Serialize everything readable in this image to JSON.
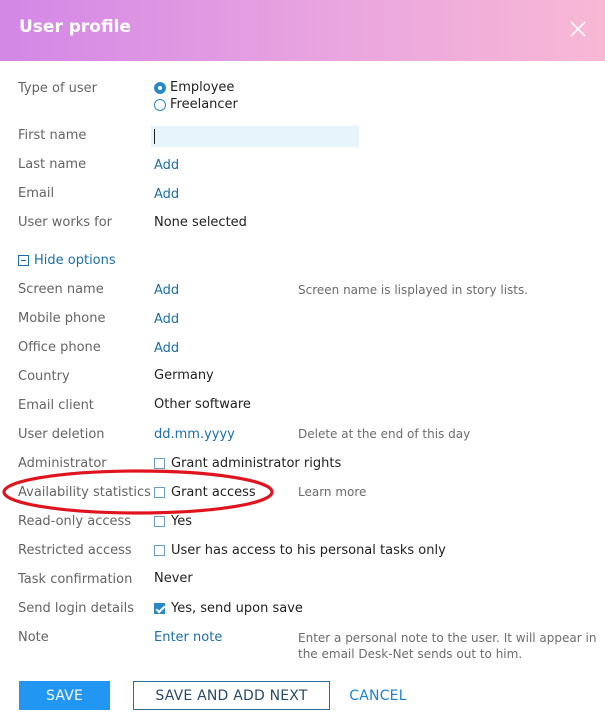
{
  "dialog": {
    "title": "User profile"
  },
  "rows": {
    "type_of_user": {
      "label": "Type of user",
      "options": [
        "Employee",
        "Freelancer"
      ],
      "selected": "Employee"
    },
    "first_name": {
      "label": "First name",
      "value": ""
    },
    "last_name": {
      "label": "Last name",
      "link": "Add"
    },
    "email": {
      "label": "Email",
      "link": "Add"
    },
    "works_for": {
      "label": "User works for",
      "value": "None selected"
    },
    "hide_options": {
      "label": "Hide options"
    },
    "screen_name": {
      "label": "Screen name",
      "link": "Add",
      "hint": "Screen name is  lisplayed in story lists."
    },
    "mobile_phone": {
      "label": "Mobile phone",
      "link": "Add"
    },
    "office_phone": {
      "label": "Office phone",
      "link": "Add"
    },
    "country": {
      "label": "Country",
      "value": "Germany"
    },
    "email_client": {
      "label": "Email client",
      "value": "Other software"
    },
    "user_deletion": {
      "label": "User deletion",
      "link": "dd.mm.yyyy",
      "hint": "Delete at the end of this day"
    },
    "administrator": {
      "label": "Administrator",
      "check_label": "Grant administrator rights",
      "checked": false
    },
    "availability": {
      "label": "Availability statistics",
      "check_label": "Grant access",
      "checked": false,
      "link": "Learn more"
    },
    "read_only": {
      "label": "Read-only access",
      "check_label": "Yes",
      "checked": false
    },
    "restricted": {
      "label": "Restricted access",
      "check_label": "User has access to his personal tasks only",
      "checked": false
    },
    "task_confirmation": {
      "label": "Task confirmation",
      "value": "Never"
    },
    "send_login": {
      "label": "Send login details",
      "check_label": "Yes, send upon save",
      "checked": true
    },
    "note": {
      "label": "Note",
      "link": "Enter note",
      "hint_line1": "Enter a personal note to the user. It will appear in",
      "hint_line2": "the email Desk-Net sends out to him."
    }
  },
  "buttons": {
    "save": "SAVE",
    "save_next": "SAVE AND ADD NEXT",
    "cancel": "CANCEL"
  },
  "colors": {
    "accent": "#2196f3",
    "link": "#1b6fa8",
    "highlight_ellipse": "#e0141e"
  }
}
